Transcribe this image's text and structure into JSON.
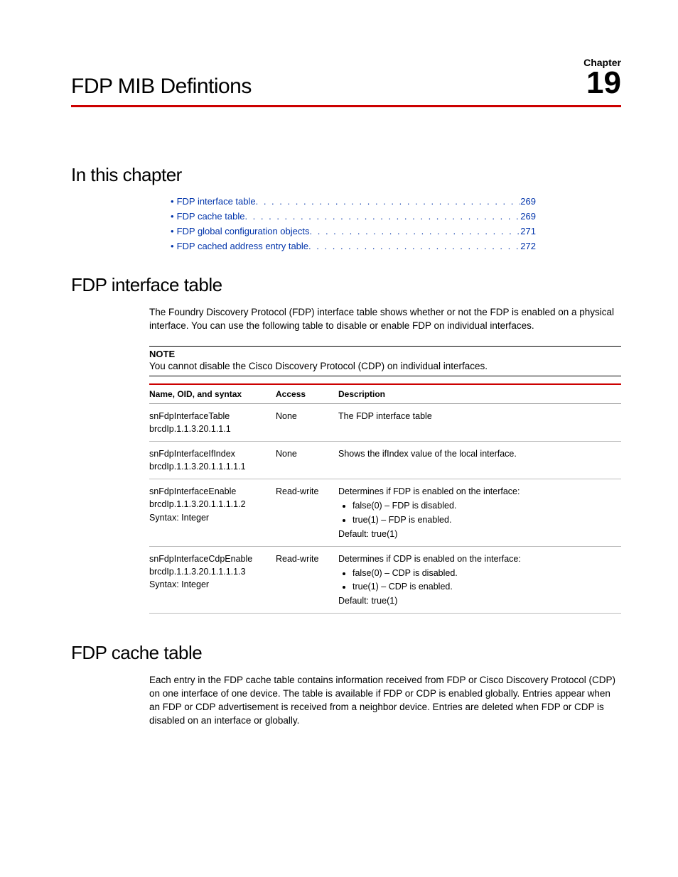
{
  "header": {
    "chapterLabel": "Chapter",
    "title": "FDP MIB Defintions",
    "chapterNumber": "19"
  },
  "toc": {
    "heading": "In this chapter",
    "items": [
      {
        "label": "FDP interface table",
        "page": "269"
      },
      {
        "label": "FDP cache table",
        "page": "269"
      },
      {
        "label": "FDP global configuration objects",
        "page": "271"
      },
      {
        "label": "FDP cached address entry table",
        "page": "272"
      }
    ]
  },
  "section1": {
    "heading": "FDP interface table",
    "intro": "The Foundry Discovery Protocol (FDP) interface table shows whether or not the FDP is enabled on a physical interface. You can use the following table to disable or enable FDP on individual interfaces.",
    "noteLabel": "NOTE",
    "noteText": "You cannot disable the Cisco Discovery Protocol (CDP) on individual interfaces.",
    "table": {
      "headers": {
        "c1": "Name, OID, and syntax",
        "c2": "Access",
        "c3": "Description"
      },
      "rows": [
        {
          "name": "snFdpInterfaceTable",
          "oid": "brcdIp.1.1.3.20.1.1.1",
          "syntax": "",
          "access": "None",
          "descIntro": "The FDP interface table",
          "opt0": "",
          "opt1": "",
          "descDefault": ""
        },
        {
          "name": "snFdpInterfaceIfIndex",
          "oid": "brcdIp.1.1.3.20.1.1.1.1.1",
          "syntax": "",
          "access": "None",
          "descIntro": "Shows the ifIndex value of the local interface.",
          "opt0": "",
          "opt1": "",
          "descDefault": ""
        },
        {
          "name": "snFdpInterfaceEnable",
          "oid": "brcdIp.1.1.3.20.1.1.1.1.2",
          "syntax": "Syntax: Integer",
          "access": "Read-write",
          "descIntro": "Determines if FDP is enabled on the interface:",
          "opt0": "false(0) – FDP is disabled.",
          "opt1": "true(1) – FDP is enabled.",
          "descDefault": "Default: true(1)"
        },
        {
          "name": "snFdpInterfaceCdpEnable",
          "oid": "brcdIp.1.1.3.20.1.1.1.1.3",
          "syntax": "Syntax: Integer",
          "access": "Read-write",
          "descIntro": "Determines if CDP is enabled on the interface:",
          "opt0": "false(0) – CDP is disabled.",
          "opt1": "true(1) – CDP is enabled.",
          "descDefault": "Default: true(1)"
        }
      ]
    }
  },
  "section2": {
    "heading": "FDP cache table",
    "intro": "Each entry in the FDP cache table contains information received from FDP or Cisco Discovery Protocol (CDP) on one interface of one device. The table is available if FDP or CDP is enabled globally. Entries appear when an FDP or CDP advertisement is received from a neighbor device. Entries are deleted when FDP or CDP is disabled on an interface or globally."
  }
}
